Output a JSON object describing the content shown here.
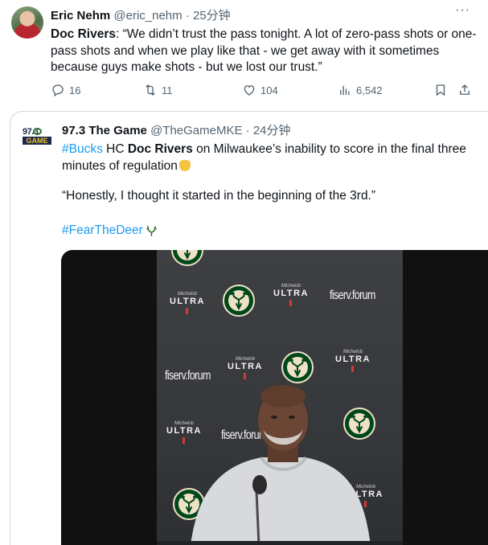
{
  "tweet": {
    "author_name": "Eric Nehm",
    "author_handle": "@eric_nehm",
    "separator": "·",
    "time": "25分钟",
    "more_label": "···",
    "quote_speaker": "Doc Rivers",
    "text": ": “We didn’t trust the pass tonight. A lot of zero-pass shots or one-pass shots and when we play like that - we get away with it sometimes because guys make shots - but we lost our trust.”",
    "stats": {
      "replies": "16",
      "reposts": "11",
      "likes": "104",
      "views": "6,542"
    },
    "icons": [
      "reply-icon",
      "repost-icon",
      "like-icon",
      "views-icon",
      "bookmark-icon",
      "share-icon"
    ]
  },
  "quoted_tweet": {
    "logo": {
      "top": "97.3",
      "bottom": "GAME"
    },
    "author_name": "97.3 The Game",
    "author_handle": "@TheGameMKE",
    "separator": "·",
    "time": "24分钟",
    "hashtag1": "#Bucks",
    "text_hc": " HC ",
    "coach": "Doc Rivers",
    "text_rest": " on Milwaukee’s inability to score in the final three minutes of regulation",
    "quote": "“Honestly, I thought it started in the beginning of the 3rd.”",
    "hashtag2": "#FearTheDeer",
    "video": {
      "backdrop": {
        "ultra": "ULTRA",
        "ultra_small": "Michelob",
        "fiserv": "fiserv.forum",
        "badge_text": "MILWAUKEE BUCKS"
      }
    }
  },
  "colors": {
    "link": "#1d9bf0",
    "muted": "#536471",
    "text": "#0f1419",
    "bucks_green": "#00471b",
    "bucks_cream": "#eee1c6"
  }
}
